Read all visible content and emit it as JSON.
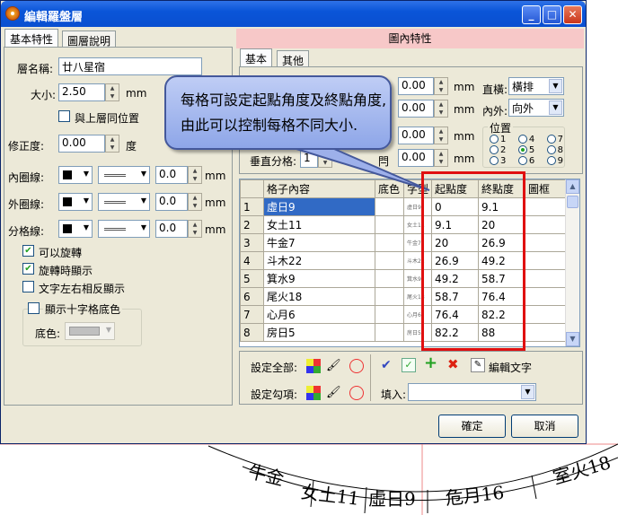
{
  "window": {
    "title": "編輯羅盤層"
  },
  "left_tabs": [
    "基本特性",
    "圖層說明"
  ],
  "right_header": "圖內特性",
  "right_tabs": [
    "基本",
    "其他"
  ],
  "left": {
    "layer_name_label": "層名稱:",
    "layer_name_value": "廿八星宿",
    "size_label": "大小:",
    "size_value": "2.50",
    "size_unit": "mm",
    "same_size_label": "與上層同位置",
    "correction_label": "修正度:",
    "correction_value": "0.00",
    "correction_unit": "度",
    "inner_line_label": "內圈線:",
    "outer_line_label": "外圈線:",
    "divider_line_label": "分格線:",
    "line_width_value": "0.0",
    "line_unit": "mm",
    "rotatable_label": "可以旋轉",
    "show_on_rotate_label": "旋轉時顯示",
    "mirror_text_label": "文字左右相反顯示",
    "show_cross_bg_label": "顯示十字格底色",
    "bg_color_label": "底色:"
  },
  "right": {
    "field1_value": "0.00",
    "field2_value": "0.00",
    "field3_value": "0.00",
    "unit_mm": "mm",
    "orientation_label": "直橫:",
    "orientation_value": "橫排",
    "inout_label": "內外:",
    "inout_value": "向外",
    "position_label": "位置",
    "vertical_div_label": "垂直分格:",
    "vertical_div_value": "1",
    "positions": [
      "1",
      "2",
      "3",
      "4",
      "5",
      "6",
      "7",
      "8",
      "9"
    ],
    "selected_position": "5"
  },
  "grid": {
    "headers": [
      "格子內容",
      "底色",
      "字型",
      "起點度",
      "終點度",
      "圖框"
    ],
    "rows": [
      {
        "n": "1",
        "content": "虛日9",
        "font": "虛日9",
        "start": "0",
        "end": "9.1"
      },
      {
        "n": "2",
        "content": "女土11",
        "font": "女土11",
        "start": "9.1",
        "end": "20"
      },
      {
        "n": "3",
        "content": "牛金7",
        "font": "牛金7",
        "start": "20",
        "end": "26.9"
      },
      {
        "n": "4",
        "content": "斗木22",
        "font": "斗木22",
        "start": "26.9",
        "end": "49.2"
      },
      {
        "n": "5",
        "content": "箕水9",
        "font": "箕水9",
        "start": "49.2",
        "end": "58.7"
      },
      {
        "n": "6",
        "content": "尾火18",
        "font": "尾火18",
        "start": "58.7",
        "end": "76.4"
      },
      {
        "n": "7",
        "content": "心月6",
        "font": "心月6",
        "start": "76.4",
        "end": "82.2"
      },
      {
        "n": "8",
        "content": "房日5",
        "font": "房日5",
        "start": "82.2",
        "end": "88"
      }
    ]
  },
  "bottom": {
    "set_all_label": "設定全部:",
    "set_checked_label": "設定勾項:",
    "edit_text_label": "編輯文字",
    "fill_label": "填入:",
    "ok_label": "確定",
    "cancel_label": "取消"
  },
  "callout": {
    "text": "每格可設定起點角度及終點角度,由此可以控制每格不同大小."
  },
  "dial_labels": [
    "牛金",
    "女土11",
    "虛日9",
    "危月16",
    "室火18"
  ],
  "colors": {
    "title_blue": "#0a55d8",
    "pink_header": "#f7c8c8",
    "highlight_red": "#e01010",
    "selection": "#316ac5"
  }
}
